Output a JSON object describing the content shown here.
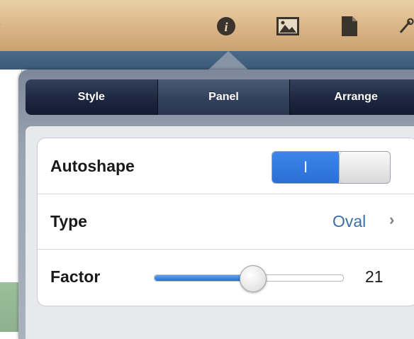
{
  "toolbar": {
    "icons": [
      "info-icon",
      "image-icon",
      "document-icon",
      "tools-icon"
    ],
    "active_icon": "info-icon"
  },
  "tabs": [
    {
      "label": "Style",
      "selected": false
    },
    {
      "label": "Panel",
      "selected": true
    },
    {
      "label": "Arrange",
      "selected": false
    }
  ],
  "settings": {
    "autoshape": {
      "label": "Autoshape",
      "toggle_text": "I",
      "enabled": true
    },
    "type": {
      "label": "Type",
      "value": "Oval"
    },
    "factor": {
      "label": "Factor",
      "value": "21",
      "level": 0.52
    }
  },
  "colors": {
    "accent": "#2a6fd6",
    "value_text": "#3b6fa8",
    "toolbar_wood": "#dcb98b"
  }
}
